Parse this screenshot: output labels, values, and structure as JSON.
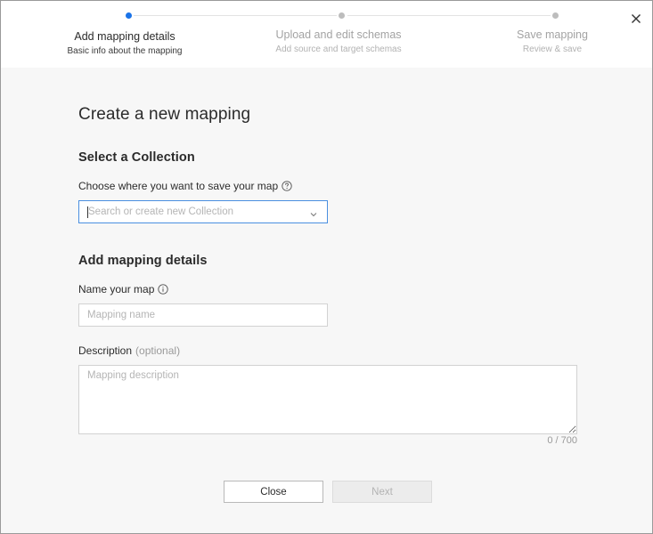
{
  "stepper": {
    "steps": [
      {
        "title": "Add mapping details",
        "subtitle": "Basic info about the mapping",
        "state": "active"
      },
      {
        "title": "Upload and edit schemas",
        "subtitle": "Add source and target schemas",
        "state": "pending"
      },
      {
        "title": "Save mapping",
        "subtitle": "Review & save",
        "state": "pending"
      }
    ]
  },
  "heading": "Create a new mapping",
  "collection": {
    "section_title": "Select a Collection",
    "label": "Choose where you want to save your map",
    "placeholder": "Search or create new Collection",
    "value": ""
  },
  "details": {
    "section_title": "Add mapping details",
    "name_label": "Name your map",
    "name_placeholder": "Mapping name",
    "name_value": "",
    "description_label": "Description",
    "description_optional": "(optional)",
    "description_placeholder": "Mapping description",
    "description_value": "",
    "counter": "0 / 700"
  },
  "buttons": {
    "close_label": "Close",
    "next_label": "Next"
  },
  "colors": {
    "accent": "#1a73e8",
    "focus_border": "#4a8fe0",
    "inactive_text": "#a3a3a3",
    "panel_background": "#f7f7f7"
  },
  "icons": {
    "modal_close": "close-icon",
    "collection_help": "question-circle-icon",
    "name_info": "info-circle-icon",
    "combo_chevron": "chevron-down-icon"
  }
}
